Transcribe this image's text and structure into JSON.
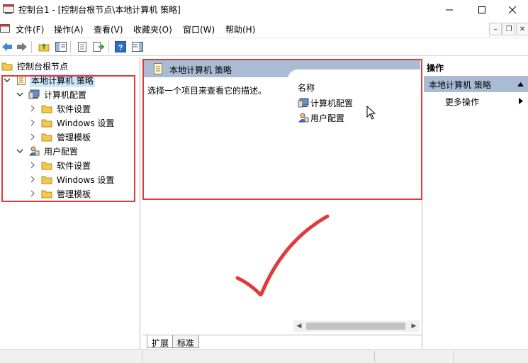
{
  "window": {
    "title": "控制台1 - [控制台根节点\\本地计算机 策略]"
  },
  "menubar": {
    "items": [
      {
        "label": "文件(F)"
      },
      {
        "label": "操作(A)"
      },
      {
        "label": "查看(V)"
      },
      {
        "label": "收藏夹(O)"
      },
      {
        "label": "窗口(W)"
      },
      {
        "label": "帮助(H)"
      }
    ]
  },
  "tree": {
    "root": "控制台根节点",
    "policy": "本地计算机 策略",
    "computer_config": "计算机配置",
    "user_config": "用户配置",
    "computer_children": [
      "软件设置",
      "Windows 设置",
      "管理模板"
    ],
    "user_children": [
      "软件设置",
      "Windows 设置",
      "管理模板"
    ]
  },
  "middle": {
    "header_title": "本地计算机 策略",
    "description": "选择一个项目来查看它的描述。",
    "column_name": "名称",
    "items": [
      {
        "label": "计算机配置",
        "icon": "computer-config-icon"
      },
      {
        "label": "用户配置",
        "icon": "user-config-icon"
      }
    ],
    "tabs": [
      {
        "label": "扩展"
      },
      {
        "label": "标准"
      }
    ]
  },
  "actions": {
    "title": "操作",
    "section": "本地计算机 策略",
    "more": "更多操作"
  },
  "colors": {
    "selection": "#cce8ff",
    "header_blue": "#a9bcd4",
    "annotation_red": "#e03a3a",
    "folder_yellow": "#f5c84c"
  }
}
